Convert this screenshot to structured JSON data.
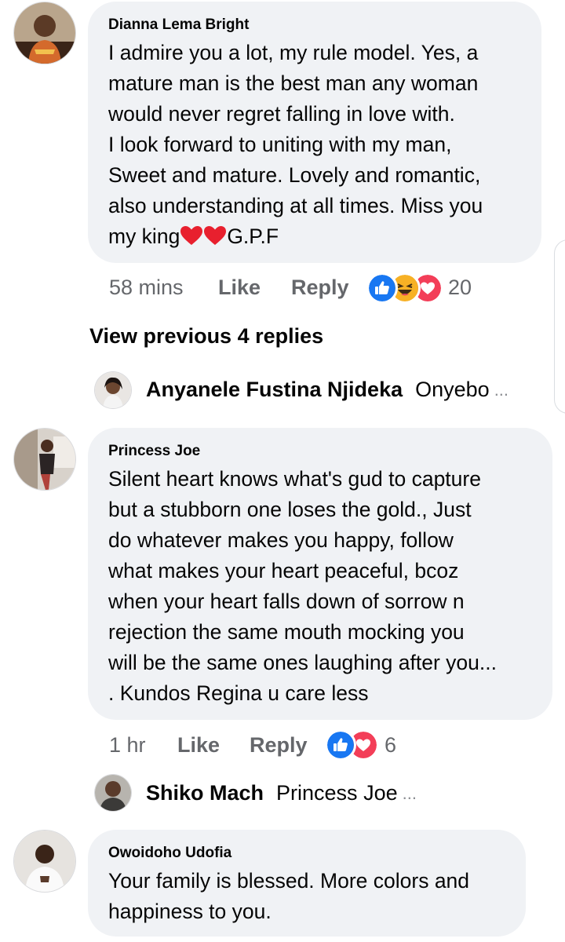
{
  "comments": [
    {
      "author": "Dianna Lema Bright",
      "text_before_emoji": "I admire you a lot, my rule model. Yes, a\nmature man is the best man any woman\nwould never regret falling in love with.\nI look forward to uniting with my man,\nSweet and mature. Lovely and romantic,\nalso understanding at all times. Miss you\nmy king",
      "text_after_emoji": "G.P.F",
      "emoji": [
        "red-heart",
        "red-heart"
      ],
      "time": "58 mins",
      "like_label": "Like",
      "reply_label": "Reply",
      "reactions": [
        "like",
        "haha",
        "love"
      ],
      "reaction_count": "20"
    },
    {
      "author": "Princess Joe",
      "text": "Silent heart knows what's gud to capture\nbut a stubborn one loses the gold., Just\ndo whatever makes you happy, follow\nwhat makes your heart peaceful, bcoz\nwhen your heart falls down of sorrow n\nrejection the same mouth mocking you\nwill be the same ones laughing after you...\n. Kundos Regina u care less",
      "time": "1 hr",
      "like_label": "Like",
      "reply_label": "Reply",
      "reactions": [
        "like",
        "love"
      ],
      "reaction_count": "6"
    },
    {
      "author": "Owoidoho Udofia",
      "text": "Your family is blessed. More colors and\nhappiness to you."
    }
  ],
  "view_previous": "View previous 4 replies",
  "replies": [
    {
      "name": "Anyanele Fustina Njideka",
      "snippet": "Onyebo",
      "ellipsis": "..."
    },
    {
      "name": "Shiko Mach",
      "snippet": "Princess Joe",
      "ellipsis": "..."
    }
  ],
  "colors": {
    "bubble": "#f0f2f5",
    "text": "#050505",
    "secondary_text": "#65676b",
    "like_blue": "#1877f2",
    "love_red": "#f33e58",
    "haha_yellow": "#f7b125"
  }
}
